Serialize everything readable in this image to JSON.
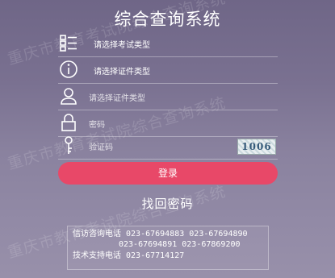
{
  "watermark_text": "重庆市教育考试院综合查询系统",
  "title": "综合查询系统",
  "form": {
    "exam_type_placeholder": "请选择考试类型",
    "id_type_placeholder": "请选择证件类型",
    "id_number_placeholder": "请选择证件类型",
    "password_placeholder": "密码",
    "captcha_placeholder": "验证码",
    "captcha_text": "1006"
  },
  "icons": {
    "exam_type": "list-icon",
    "id_type": "info-icon",
    "id_number": "user-icon",
    "password": "lock-icon",
    "captcha": "key-icon"
  },
  "buttons": {
    "login": "登录",
    "forgot_password": "找回密码"
  },
  "contact": {
    "line1": "信访咨询电话  023-67694883  023-67694890",
    "line2": "023-67694891  023-67869200",
    "line3": "技术支持电话  023-67714127"
  },
  "colors": {
    "login_button": "#e84868",
    "background_top": "#6f6687",
    "background_bottom": "#9890aa"
  }
}
